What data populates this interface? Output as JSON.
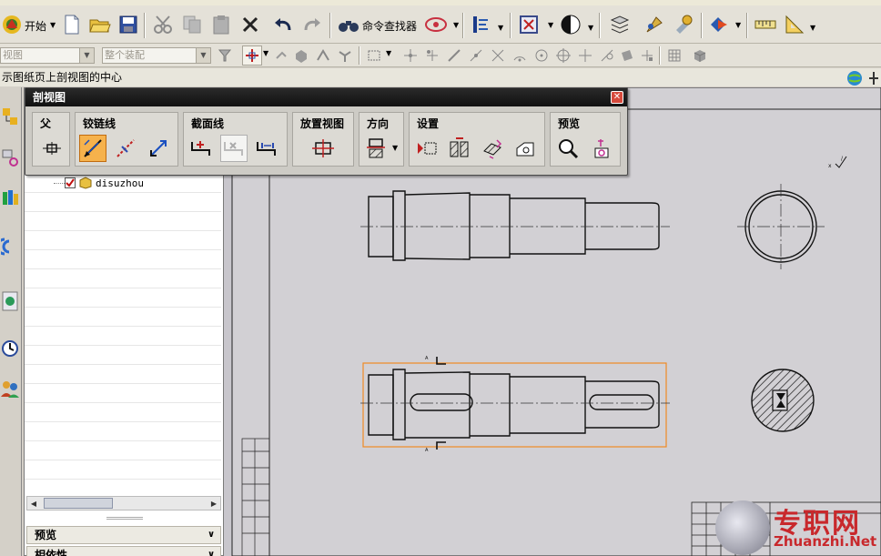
{
  "toolbar": {
    "start_label": "开始",
    "command_finder_label": "命令查找器"
  },
  "toolbar2": {
    "view_combo": "视图",
    "assembly_combo": "整个装配"
  },
  "status": {
    "message": "示图纸页上剖视图的中心"
  },
  "navigator": {
    "tree_item": "disuzhou",
    "section_preview": "预览",
    "section_dependency": "相依性"
  },
  "dialog": {
    "title": "剖视图",
    "groups": {
      "parent": "父",
      "hinge_line": "铰链线",
      "section_line": "截面线",
      "place_view": "放置视图",
      "orientation": "方向",
      "settings": "设置",
      "preview": "预览"
    }
  },
  "watermark": {
    "cn": "专职网",
    "en": "Zhuanzhi.Net"
  },
  "colors": {
    "selection_orange": "#f08a24",
    "watermark_red": "#c8282c",
    "title_bar": "#1a1a1a"
  }
}
